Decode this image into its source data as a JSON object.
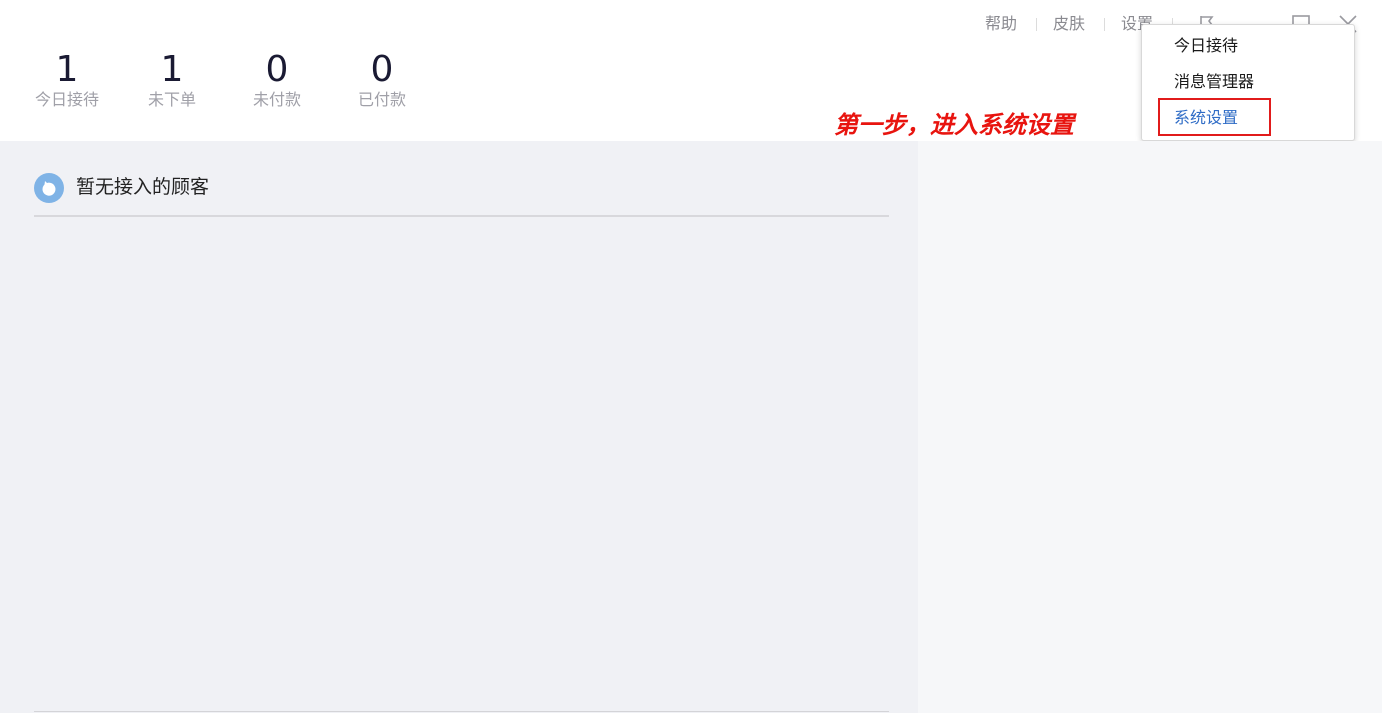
{
  "stats": [
    {
      "value": "1",
      "label": "今日接待"
    },
    {
      "value": "1",
      "label": "未下单"
    },
    {
      "value": "0",
      "label": "未付款"
    },
    {
      "value": "0",
      "label": "已付款"
    }
  ],
  "top_links": {
    "help": "帮助",
    "skin": "皮肤",
    "settings": "设置"
  },
  "window_icons": [
    "flag-icon",
    "minimize-icon",
    "maximize-icon",
    "close-icon"
  ],
  "dropdown": {
    "items": [
      {
        "label": "今日接待"
      },
      {
        "label": "消息管理器"
      },
      {
        "label": "系统设置",
        "highlighted": true
      }
    ]
  },
  "annotation": "第一步，进入系统设置",
  "customer_list": {
    "empty_text": "暂无接入的顾客"
  },
  "colors": {
    "annotation": "#e8140f",
    "highlight_border": "#e11b1b",
    "active_item": "#2f6cc6",
    "left_panel_bg": "#f0f1f5",
    "right_panel_bg": "#f6f7f9",
    "empty_icon": "#7fb3e6"
  }
}
